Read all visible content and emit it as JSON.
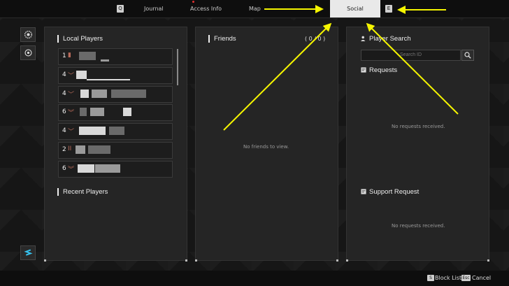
{
  "nav": {
    "key_q": "Q",
    "journal": "Journal",
    "access_info": "Access Info",
    "map": "Map",
    "social": "Social",
    "key_e": "E"
  },
  "local_players": {
    "title": "Local Players",
    "rows": [
      {
        "level": "1"
      },
      {
        "level": "4"
      },
      {
        "level": "4"
      },
      {
        "level": "6"
      },
      {
        "level": "4"
      },
      {
        "level": "2"
      },
      {
        "level": "6"
      }
    ]
  },
  "recent_players": {
    "title": "Recent Players"
  },
  "friends": {
    "title": "Friends",
    "count": "( 0 / 0 )",
    "empty": "No friends to view."
  },
  "player_search": {
    "title": "Player Search",
    "placeholder": "Search ID"
  },
  "requests": {
    "title": "Requests",
    "empty": "No requests received."
  },
  "support_request": {
    "title": "Support Request",
    "empty": "No requests received."
  },
  "footer": {
    "key_block": "S",
    "block_list": "Block List",
    "key_esc": "Esc",
    "cancel": "Cancel"
  },
  "colors": {
    "annotation_arrow": "#f5f500",
    "active_tab": "#e9e9e9"
  },
  "icons": [
    "gear-badge-icon",
    "settings-icon",
    "app-logo-icon",
    "search-icon",
    "person-search-icon",
    "request-icon",
    "support-icon",
    "rank-chevron-icon"
  ]
}
